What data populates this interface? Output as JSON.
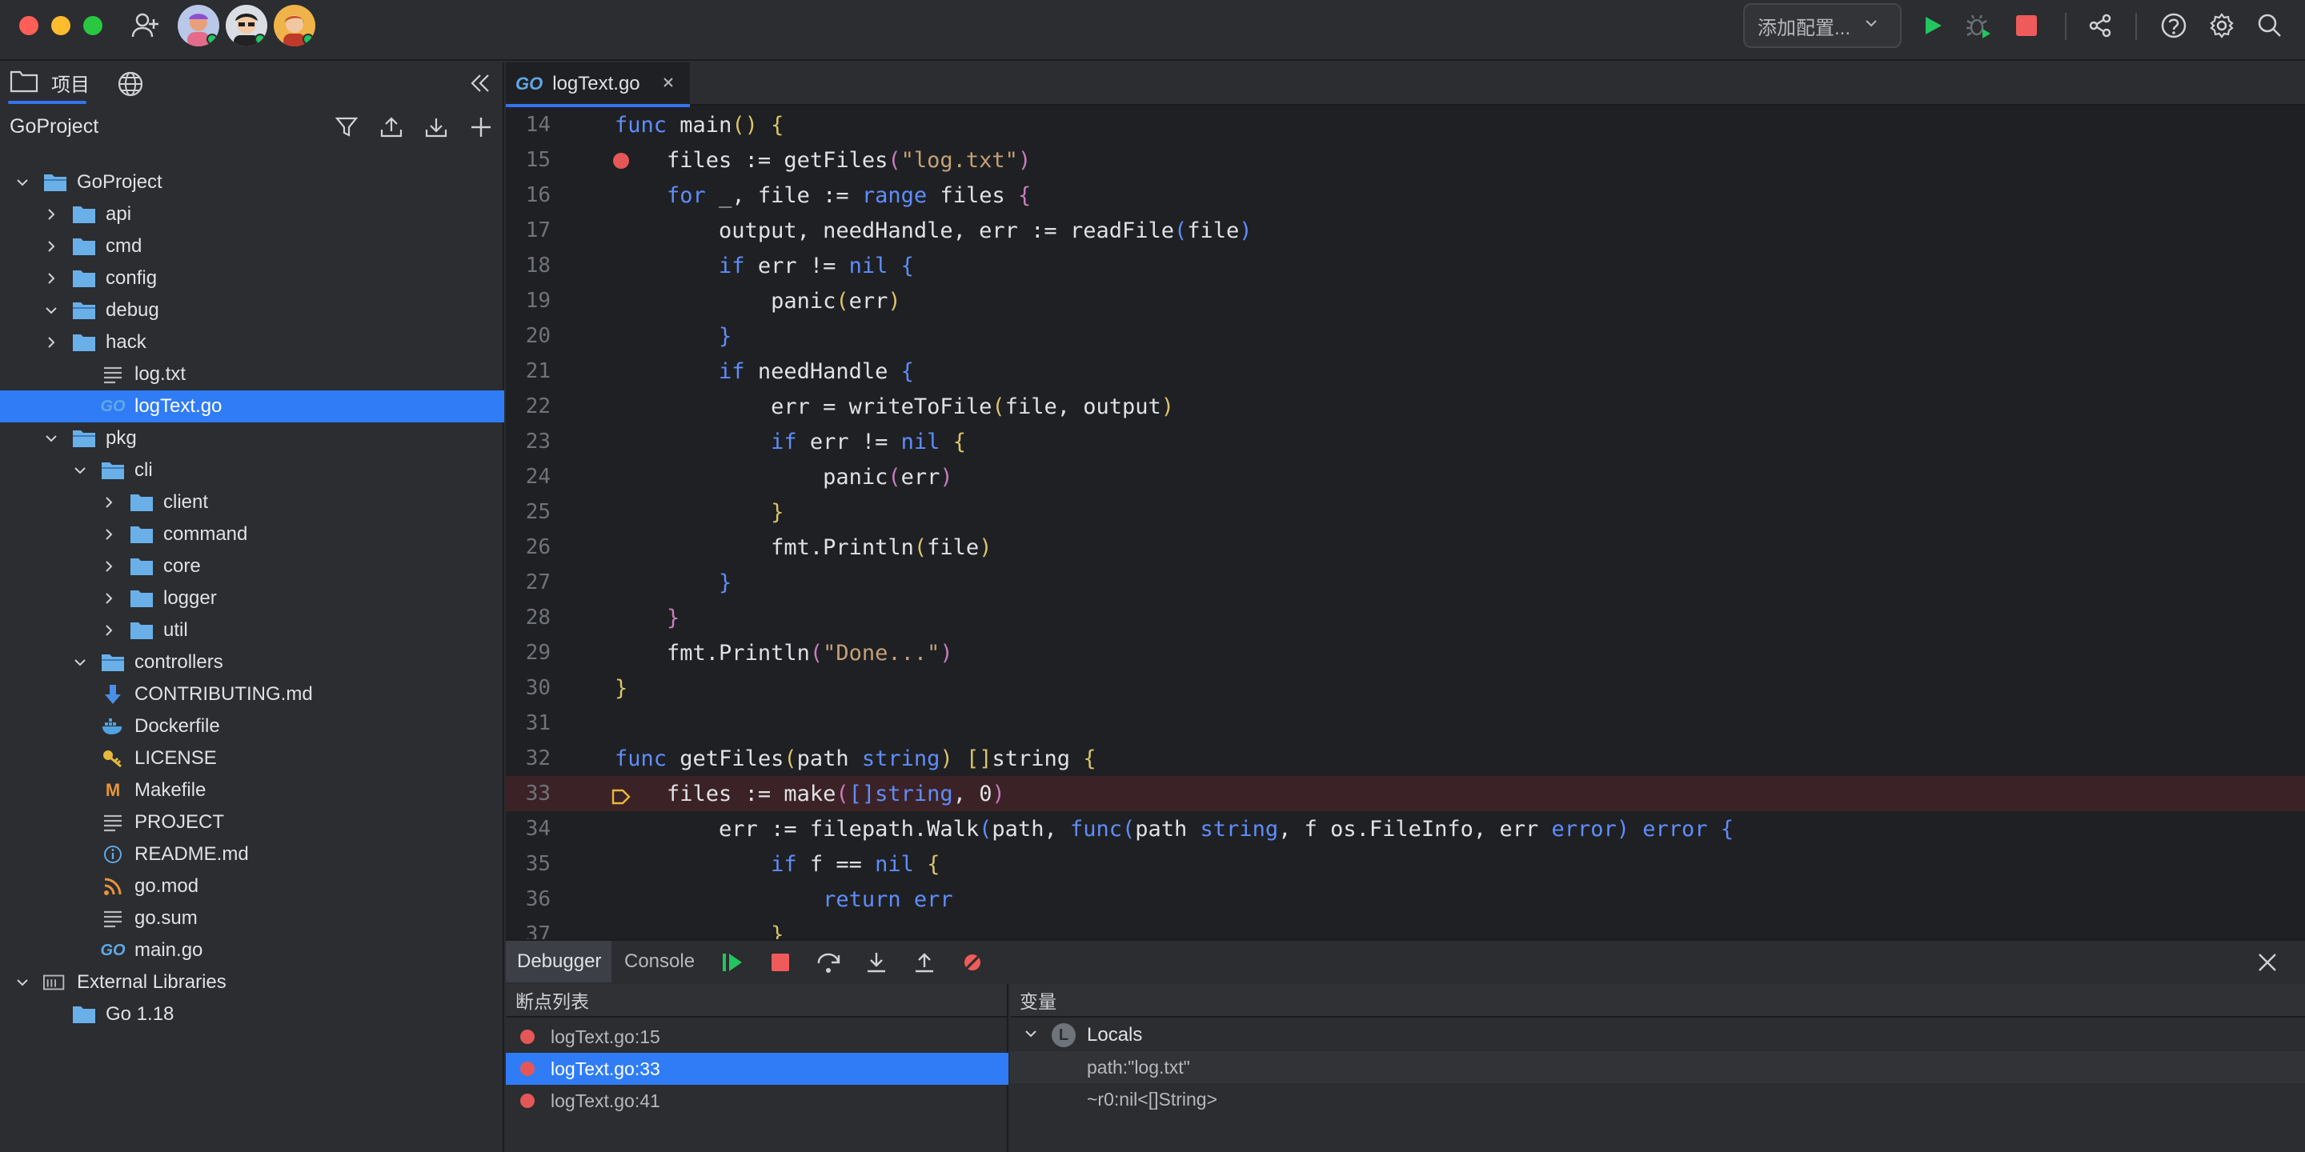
{
  "titlebar": {
    "config_label": "添加配置...",
    "icons": [
      "add-user-icon",
      "avatar-1",
      "avatar-2",
      "avatar-3",
      "run-icon",
      "debug-icon",
      "stop-icon",
      "share-icon",
      "help-icon",
      "settings-icon",
      "search-icon"
    ],
    "colors": {
      "run": "#22c55e",
      "stop": "#ef5b5b"
    }
  },
  "left_panel": {
    "tab_project_label": "项目",
    "header_title": "GoProject",
    "tree": [
      {
        "label": "GoProject",
        "type": "folder",
        "open": true,
        "depth": 0
      },
      {
        "label": "api",
        "type": "folder",
        "open": false,
        "depth": 1
      },
      {
        "label": "cmd",
        "type": "folder",
        "open": false,
        "depth": 1
      },
      {
        "label": "config",
        "type": "folder",
        "open": false,
        "depth": 1
      },
      {
        "label": "debug",
        "type": "folder",
        "open": true,
        "depth": 1
      },
      {
        "label": "hack",
        "type": "folder",
        "open": false,
        "depth": 1
      },
      {
        "label": "log.txt",
        "type": "text",
        "depth": 2
      },
      {
        "label": "logText.go",
        "type": "go",
        "depth": 2,
        "selected": true
      },
      {
        "label": "pkg",
        "type": "folder",
        "open": true,
        "depth": 1
      },
      {
        "label": "cli",
        "type": "folder",
        "open": true,
        "depth": 2
      },
      {
        "label": "client",
        "type": "folder",
        "open": false,
        "depth": 3
      },
      {
        "label": "command",
        "type": "folder",
        "open": false,
        "depth": 3
      },
      {
        "label": "core",
        "type": "folder",
        "open": false,
        "depth": 3
      },
      {
        "label": "logger",
        "type": "folder",
        "open": false,
        "depth": 3
      },
      {
        "label": "util",
        "type": "folder",
        "open": false,
        "depth": 3
      },
      {
        "label": "controllers",
        "type": "folder",
        "open": true,
        "depth": 2
      },
      {
        "label": "CONTRIBUTING.md",
        "type": "md-down",
        "depth": 2
      },
      {
        "label": "Dockerfile",
        "type": "docker",
        "depth": 2
      },
      {
        "label": "LICENSE",
        "type": "key",
        "depth": 2
      },
      {
        "label": "Makefile",
        "type": "make",
        "depth": 2
      },
      {
        "label": "PROJECT",
        "type": "text",
        "depth": 2
      },
      {
        "label": "README.md",
        "type": "info",
        "depth": 2
      },
      {
        "label": "go.mod",
        "type": "rss",
        "depth": 2
      },
      {
        "label": "go.sum",
        "type": "text",
        "depth": 2
      },
      {
        "label": "main.go",
        "type": "go",
        "depth": 2
      },
      {
        "label": "External Libraries",
        "type": "lib",
        "open": true,
        "depth": 0
      },
      {
        "label": "Go 1.18",
        "type": "folder",
        "depth": 1
      }
    ]
  },
  "editor": {
    "tab_label": "logText.go",
    "tab_icon_text": "GO",
    "lines": [
      {
        "n": "14",
        "html": "<span class='kw'>func</span> <span class='fn'>main</span><span class='par-y'>()</span> <span class='par-y'>{</span>"
      },
      {
        "n": "15",
        "bp": true,
        "html": "    <span class='txt'>files := getFiles</span><span class='par-p'>(</span><span class='str'>\"log.txt\"</span><span class='par-p'>)</span>"
      },
      {
        "n": "16",
        "html": "    <span class='kw'>for</span> <span class='txt'>_, file :=</span> <span class='kw'>range</span> <span class='txt'>files</span> <span class='par-p'>{</span>"
      },
      {
        "n": "17",
        "html": "        <span class='txt'>output, needHandle, err := readFile</span><span class='par-b'>(</span><span class='txt'>file</span><span class='par-b'>)</span>"
      },
      {
        "n": "18",
        "html": "        <span class='kw'>if</span> <span class='txt'>err != </span><span class='kw'>nil</span> <span class='par-b'>{</span>"
      },
      {
        "n": "19",
        "html": "            <span class='txt'>panic</span><span class='par-y'>(</span><span class='txt'>err</span><span class='par-y'>)</span>"
      },
      {
        "n": "20",
        "html": "        <span class='par-b'>}</span>"
      },
      {
        "n": "21",
        "html": "        <span class='kw'>if</span> <span class='txt'>needHandle</span> <span class='par-b'>{</span>"
      },
      {
        "n": "22",
        "html": "            <span class='txt'>err = writeToFile</span><span class='par-y'>(</span><span class='txt'>file, output</span><span class='par-y'>)</span>"
      },
      {
        "n": "23",
        "html": "            <span class='kw'>if</span> <span class='txt'>err != </span><span class='kw'>nil</span> <span class='par-y'>{</span>"
      },
      {
        "n": "24",
        "html": "                <span class='txt'>panic</span><span class='par-p'>(</span><span class='txt'>err</span><span class='par-p'>)</span>"
      },
      {
        "n": "25",
        "html": "            <span class='par-y'>}</span>"
      },
      {
        "n": "26",
        "html": "            <span class='txt'>fmt.Println</span><span class='par-y'>(</span><span class='txt'>file</span><span class='par-y'>)</span>"
      },
      {
        "n": "27",
        "html": "        <span class='par-b'>}</span>"
      },
      {
        "n": "28",
        "html": "    <span class='par-p'>}</span>"
      },
      {
        "n": "29",
        "html": "    <span class='txt'>fmt.Println</span><span class='par-p'>(</span><span class='str'>\"Done...\"</span><span class='par-p'>)</span>"
      },
      {
        "n": "30",
        "html": "<span class='par-y'>}</span>"
      },
      {
        "n": "31",
        "html": ""
      },
      {
        "n": "32",
        "html": "<span class='kw'>func</span> <span class='fn'>getFiles</span><span class='par-y'>(</span><span class='txt'>path</span> <span class='typ'>string</span><span class='par-y'>)</span> <span class='par-y'>[]</span><span class='txt'>string</span> <span class='par-y'>{</span>"
      },
      {
        "n": "33",
        "exec": true,
        "html": "    <span class='txt'>files := make</span><span class='par-p'>(</span><span class='par-b'>[]</span><span class='typ'>string</span><span class='txt'>, 0</span><span class='par-p'>)</span>"
      },
      {
        "n": "34",
        "html": "        <span class='txt'>err := filepath.Walk</span><span class='par-b'>(</span><span class='txt'>path, </span><span class='kw'>func</span><span class='par-b'>(</span><span class='txt'>path </span><span class='typ'>string</span><span class='txt'>, f os.FileInfo, err </span><span class='typ'>error</span><span class='par-b'>)</span> <span class='typ'>error</span> <span class='par-b'>{</span>"
      },
      {
        "n": "35",
        "html": "            <span class='kw'>if</span> <span class='txt'>f == </span><span class='kw'>nil</span> <span class='par-y'>{</span>"
      },
      {
        "n": "36",
        "html": "                <span class='kw'>return</span> <span class='kw'>err</span>"
      },
      {
        "n": "37",
        "html": "            <span class='par-y'>}</span>"
      }
    ]
  },
  "debugger": {
    "tab_debugger": "Debugger",
    "tab_console": "Console",
    "breakpoints_header": "断点列表",
    "variables_header": "变量",
    "breakpoints": [
      "logText.go:15",
      "logText.go:33",
      "logText.go:41"
    ],
    "selected_breakpoint_index": 1,
    "locals_label": "Locals",
    "locals_badge": "L",
    "variables": [
      "path:\"log.txt\"",
      "~r0:nil<[]String>"
    ]
  }
}
